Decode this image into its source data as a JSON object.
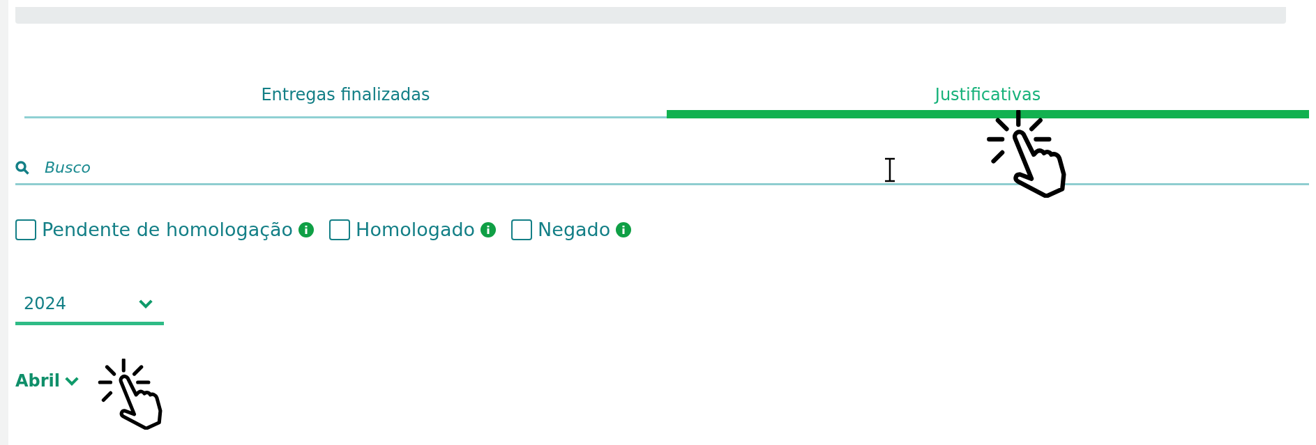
{
  "tabs": [
    {
      "label": "Entregas finalizadas",
      "selected": false
    },
    {
      "label": "Justificativas",
      "selected": true
    }
  ],
  "search": {
    "placeholder": "Busco"
  },
  "filters": [
    {
      "label": "Pendente de homologação",
      "checked": false
    },
    {
      "label": "Homologado",
      "checked": false
    },
    {
      "label": "Negado",
      "checked": false
    }
  ],
  "year_select": {
    "value": "2024"
  },
  "month_group": {
    "label": "Abril",
    "expanded": false
  }
}
